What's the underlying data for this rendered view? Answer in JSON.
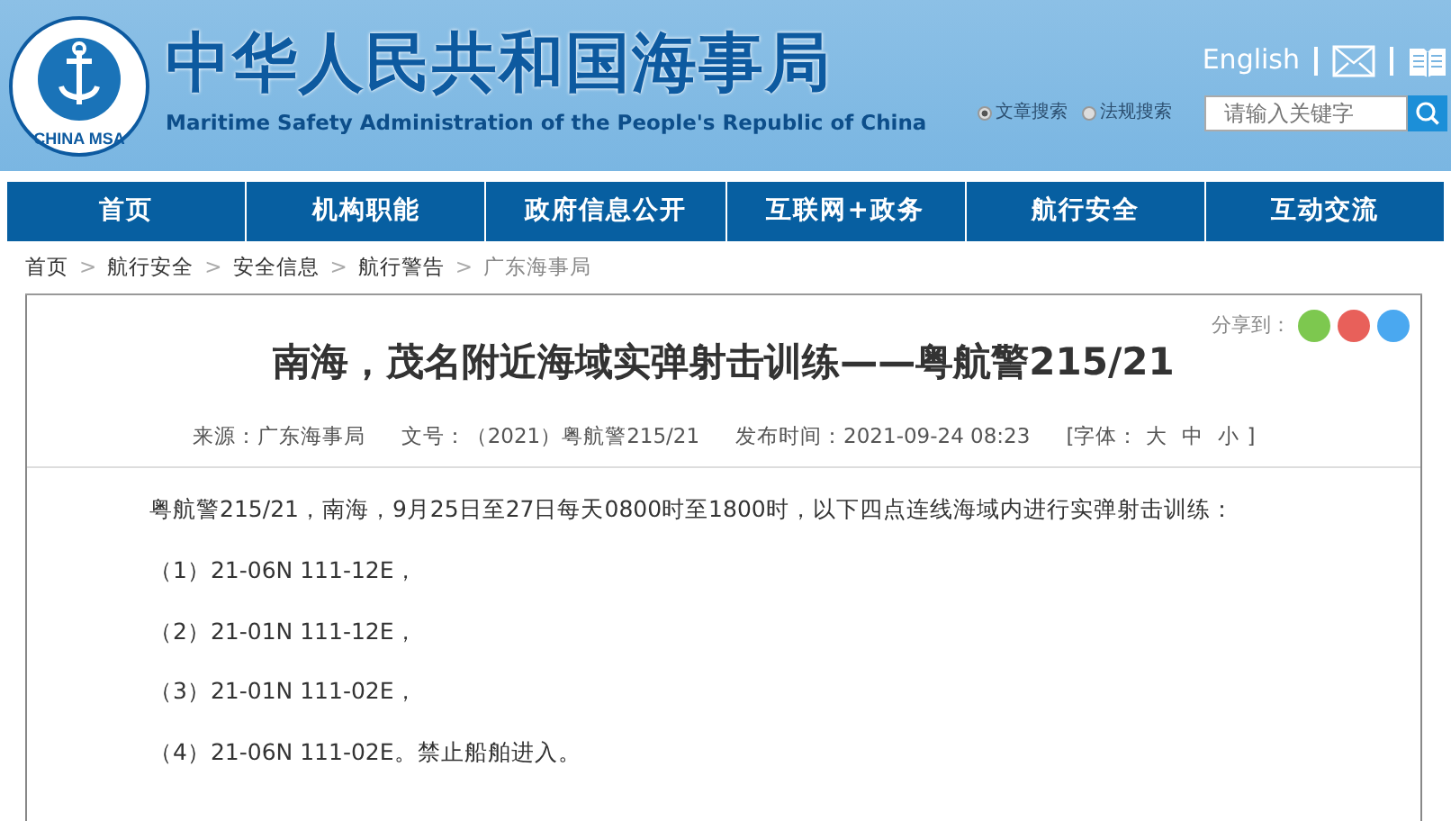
{
  "header": {
    "logo_text": "CHINA MSA",
    "title": "中华人民共和国海事局",
    "subtitle": "Maritime Safety Administration of the People's Republic of China",
    "language_link": "English",
    "search_options": [
      {
        "label": "文章搜索",
        "selected": true
      },
      {
        "label": "法规搜索",
        "selected": false
      }
    ],
    "search": {
      "placeholder": "请输入关键字"
    }
  },
  "nav": [
    {
      "label": "首页"
    },
    {
      "label": "机构职能"
    },
    {
      "label": "政府信息公开"
    },
    {
      "label": "互联网+政务"
    },
    {
      "label": "航行安全"
    },
    {
      "label": "互动交流"
    }
  ],
  "breadcrumb": [
    {
      "label": "首页"
    },
    {
      "separator": ">",
      "label": "航行安全"
    },
    {
      "separator": ">",
      "label": "安全信息"
    },
    {
      "separator": ">",
      "label": "航行警告"
    },
    {
      "separator": ">",
      "label": "广东海事局"
    }
  ],
  "share_label": "分享到：",
  "article": {
    "title": "南海，茂名附近海域实弹射击训练——粤航警215/21",
    "source": "来源：广东海事局",
    "doc_no": "文号：（2021）粤航警215/21",
    "published": "发布时间：2021-09-24 08:23",
    "font_size": {
      "label": "[字体：",
      "options": [
        "大",
        "中",
        "小"
      ],
      "close": "]"
    },
    "paragraphs": [
      "粤航警215/21，南海，9月25日至27日每天0800时至1800时，以下四点连线海域内进行实弹射击训练：",
      "（1）21-06N 111-12E，",
      "（2）21-01N 111-12E，",
      "（3）21-01N 111-02E，",
      "（4）21-06N 111-02E。禁止船舶进入。"
    ]
  }
}
